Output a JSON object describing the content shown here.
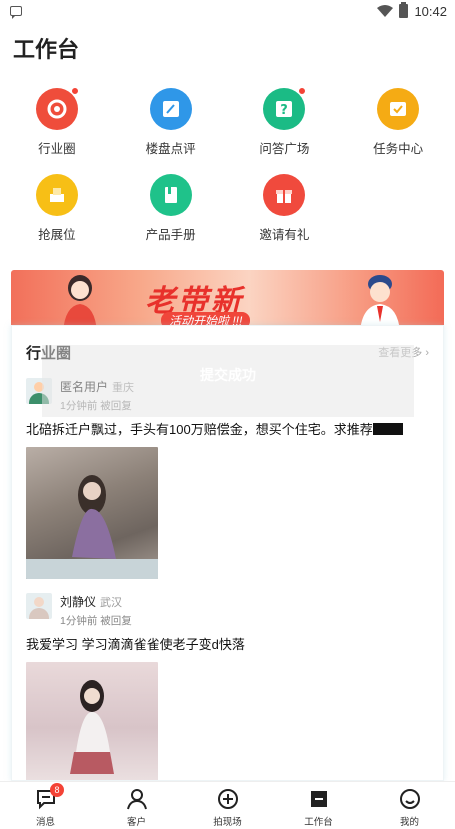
{
  "status_bar": {
    "time": "10:42"
  },
  "page": {
    "title": "工作台"
  },
  "grid_items": [
    {
      "label": "行业圈",
      "icon": "industry-circle-icon",
      "color": "#ef4d3b",
      "dot": true
    },
    {
      "label": "楼盘点评",
      "icon": "property-review-icon",
      "color": "#2f97e8",
      "dot": false
    },
    {
      "label": "问答广场",
      "icon": "qa-square-icon",
      "color": "#1bbb85",
      "dot": true
    },
    {
      "label": "任务中心",
      "icon": "task-center-icon",
      "color": "#f5ab14",
      "dot": false
    },
    {
      "label": "抢展位",
      "icon": "booth-icon",
      "color": "#f7bf16",
      "dot": false
    },
    {
      "label": "产品手册",
      "icon": "product-manual-icon",
      "color": "#1fc28a",
      "dot": false
    },
    {
      "label": "邀请有礼",
      "icon": "gift-icon",
      "color": "#f04a3d",
      "dot": false
    }
  ],
  "banner": {
    "title": "老带新",
    "subtitle": "活动开始啦 !!!"
  },
  "feed": {
    "title": "行业圈",
    "more": "查看更多",
    "posts": [
      {
        "name": "匿名用户",
        "city": "重庆",
        "meta": "1分钟前 被回复",
        "text": "北碚拆迁户飘过，手头有100万赔偿金，想买个住宅。求推荐"
      },
      {
        "name": "刘静仪",
        "city": "武汉",
        "meta": "1分钟前 被回复",
        "text": "我爱学习 学习滴滴雀雀使老子变d快落"
      }
    ]
  },
  "toast": {
    "text": "提交成功"
  },
  "bottom_nav": [
    {
      "label": "消息",
      "icon": "message-icon",
      "badge": "8"
    },
    {
      "label": "客户",
      "icon": "customer-icon",
      "badge": ""
    },
    {
      "label": "拍现场",
      "icon": "capture-scene-icon",
      "badge": ""
    },
    {
      "label": "工作台",
      "icon": "workbench-icon",
      "badge": ""
    },
    {
      "label": "我的",
      "icon": "profile-icon",
      "badge": ""
    }
  ]
}
